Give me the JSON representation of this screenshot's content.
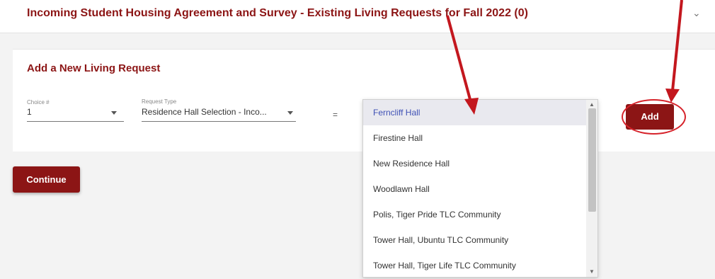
{
  "header": {
    "title": "Incoming Student Housing Agreement and Survey - Existing Living Requests for Fall 2022 (0)",
    "chevron_icon": "chevron-down-icon"
  },
  "form": {
    "title": "Add a New Living Request",
    "choice": {
      "label": "Choice #",
      "value": "1"
    },
    "request_type": {
      "label": "Request Type",
      "value": "Residence Hall Selection - Inco..."
    },
    "equals": "=",
    "options": [
      "Ferncliff Hall",
      "Firestine Hall",
      "New Residence Hall",
      "Woodlawn Hall",
      "Polis, Tiger Pride TLC Community",
      "Tower Hall, Ubuntu TLC Community",
      "Tower Hall, Tiger Life TLC Community"
    ],
    "selected_option": "Ferncliff Hall",
    "add_label": "Add"
  },
  "continue_label": "Continue",
  "colors": {
    "brand": "#8c1515",
    "annotation": "#c3171e",
    "selected_text": "#3f51b5"
  }
}
